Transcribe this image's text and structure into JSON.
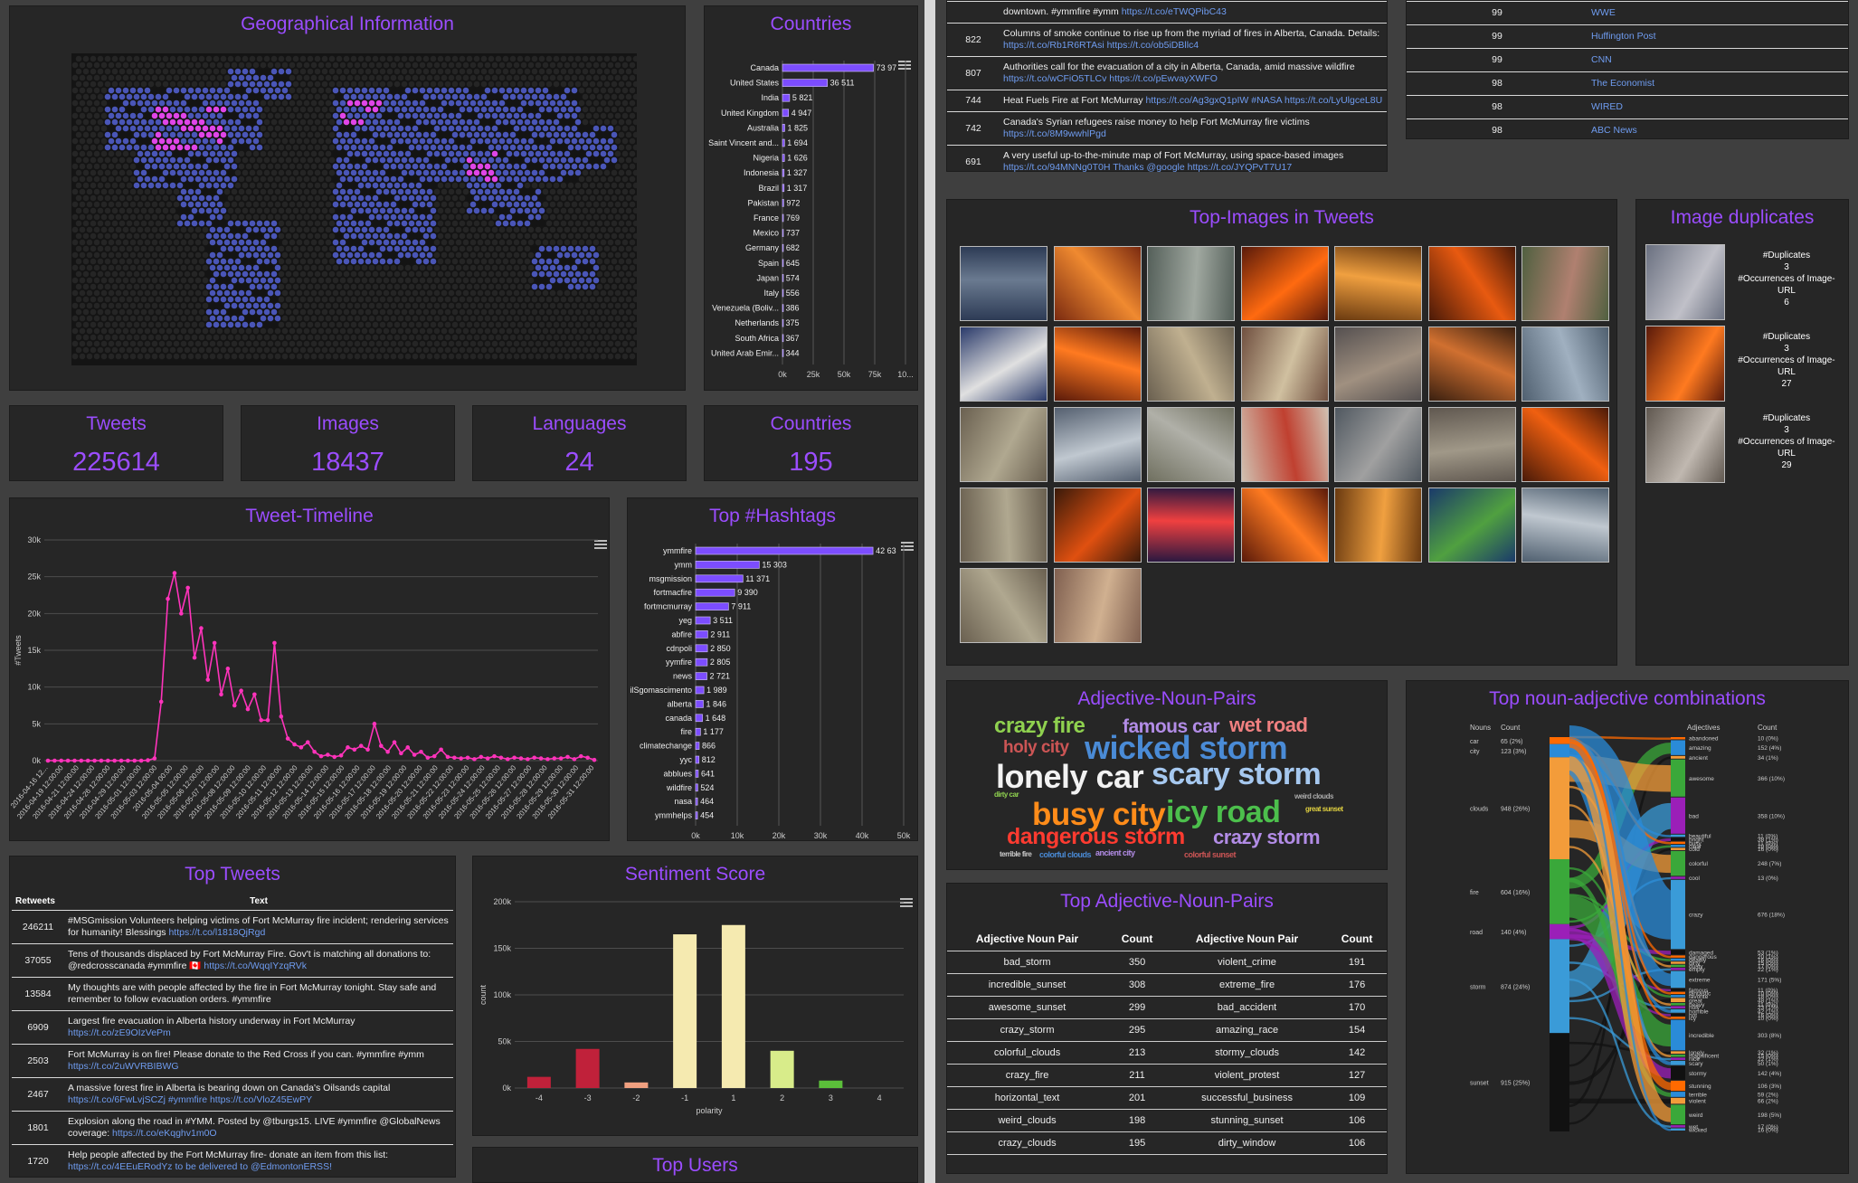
{
  "geo": {
    "title": "Geographical Information"
  },
  "countries_chart": {
    "title": "Countries",
    "chart_data": {
      "type": "bar",
      "orientation": "horizontal",
      "categories": [
        "Canada",
        "United States",
        "India",
        "United Kingdom",
        "Australia",
        "Saint Vincent and...",
        "Nigeria",
        "Indonesia",
        "Brazil",
        "Pakistan",
        "France",
        "Mexico",
        "Germany",
        "Spain",
        "Japan",
        "Italy",
        "Venezuela (Boliv...",
        "Netherlands",
        "South Africa",
        "United Arab Emir..."
      ],
      "values": [
        73970,
        36511,
        5821,
        4947,
        1825,
        1694,
        1626,
        1327,
        1317,
        972,
        769,
        737,
        682,
        645,
        574,
        556,
        386,
        375,
        367,
        344
      ],
      "value_labels": [
        "73 97",
        "36 511",
        "5 821",
        "4 947",
        "1 825",
        "1 694",
        "1 626",
        "1 327",
        "1 317",
        "972",
        "769",
        "737",
        "682",
        "645",
        "574",
        "556",
        "386",
        "375",
        "367",
        "344"
      ],
      "x_ticks": [
        "0k",
        "25k",
        "50k",
        "75k",
        "10..."
      ],
      "xlim": [
        0,
        100000
      ],
      "bar_color": "#7c4dff"
    }
  },
  "stats": [
    {
      "label": "Tweets",
      "value": "225614"
    },
    {
      "label": "Images",
      "value": "18437"
    },
    {
      "label": "Languages",
      "value": "24"
    },
    {
      "label": "Countries",
      "value": "195"
    }
  ],
  "timeline": {
    "title": "Tweet-Timeline",
    "chart_data": {
      "type": "line",
      "ylabel": "#Tweets",
      "ylim": [
        0,
        30000
      ],
      "y_ticks": [
        "0k",
        "5k",
        "10k",
        "15k",
        "20k",
        "25k",
        "30k"
      ],
      "x_ticks": [
        "2016-04-16 12...",
        "2016-04-19 12:00:00",
        "2016-04-21 12:00:00",
        "2016-04-24 12:00:00",
        "2016-04-26 12:00:00",
        "2016-04-29 12:00:00",
        "2016-05-01 12:00:00",
        "2016-05-03 12:00:00",
        "2016-05-04 00:00",
        "2016-05-05 12:00:00",
        "2016-05-06 12:00:00",
        "2016-05-07 12:00:00",
        "2016-05-08 12:00:00",
        "2016-05-09 12:00:00",
        "2016-05-10 12:00:00",
        "2016-05-11 12:00:00",
        "2016-05-12 12:00:00",
        "2016-05-13 12:00:00",
        "2016-05-14 12:00:00",
        "2016-05-15 12:00:00",
        "2016-05-16 12:00:00",
        "2016-05-17 12:00:00",
        "2016-05-18 12:00:00",
        "2016-05-19 12:00:00",
        "2016-05-20 12:00:00",
        "2016-05-21 12:00:00",
        "2016-05-22 12:00:00",
        "2016-05-23 12:00:00",
        "2016-05-24 12:00:00",
        "2016-05-25 12:00:00",
        "2016-05-26 12:00:00",
        "2016-05-27 12:00:00",
        "2016-05-28 12:00:00",
        "2016-05-29 12:00:00",
        "2016-05-30 12:00:00",
        "2016-05-31 12:00:00"
      ],
      "values": [
        0,
        0,
        0,
        0,
        0,
        0,
        0,
        0,
        0,
        0,
        0,
        0,
        0,
        0,
        0,
        50,
        300,
        8000,
        22000,
        25500,
        20000,
        23500,
        14000,
        18000,
        11000,
        16000,
        9000,
        12500,
        7500,
        9500,
        7000,
        9000,
        5500,
        5500,
        16000,
        6000,
        3000,
        2200,
        1800,
        2500,
        1200,
        600,
        800,
        500,
        700,
        1800,
        1500,
        2000,
        1500,
        5000,
        2000,
        1200,
        2500,
        1000,
        1800,
        800,
        1200,
        400,
        600,
        1500,
        500,
        400,
        300,
        400,
        200,
        500,
        300,
        600,
        400,
        200,
        400,
        300,
        200,
        400,
        300,
        200,
        300,
        300,
        500,
        200,
        600,
        400,
        100
      ],
      "color": "#ff33bb"
    }
  },
  "hashtags": {
    "title": "Top #Hashtags",
    "chart_data": {
      "type": "bar",
      "orientation": "horizontal",
      "categories": [
        "ymmfire",
        "ymm",
        "msgmission",
        "fortmacfire",
        "fortmcmurray",
        "yeg",
        "abfire",
        "cdnpoli",
        "yymfire",
        "news",
        "ilSgomascimento",
        "alberta",
        "canada",
        "fire",
        "climatechange",
        "yyc",
        "abblues",
        "wildfire",
        "nasa",
        "ymmhelps"
      ],
      "values": [
        42630,
        15303,
        11371,
        9390,
        7911,
        3511,
        2911,
        2850,
        2805,
        2721,
        1989,
        1846,
        1648,
        1177,
        866,
        812,
        641,
        524,
        464,
        454
      ],
      "value_labels": [
        "42 63",
        "15 303",
        "11 371",
        "9 390",
        "7 911",
        "3 511",
        "2 911",
        "2 850",
        "2 805",
        "2 721",
        "1 989",
        "1 846",
        "1 648",
        "1 177",
        "866",
        "812",
        "641",
        "524",
        "464",
        "454"
      ],
      "x_ticks": [
        "0k",
        "10k",
        "20k",
        "30k",
        "40k",
        "50k"
      ],
      "xlim": [
        0,
        50000
      ],
      "bar_color": "#7c4dff"
    }
  },
  "top_tweets": {
    "title": "Top Tweets",
    "col_retweets": "Retweets",
    "col_text": "Text",
    "rows": [
      {
        "count": "246211",
        "text": "#MSGmission Volunteers helping victims of Fort McMurray fire incident; rendering services for humanity! Blessings ",
        "link": "https://t.co/l1818QjRgd",
        "text2": ""
      },
      {
        "count": "37055",
        "text": "Tens of thousands displaced by Fort McMurray Fire. Gov't is matching all donations to: @redcrosscanada #ymmfire 🇨🇦 ",
        "link": "https://t.co/WqqIYzqRVk",
        "text2": ""
      },
      {
        "count": "13584",
        "text": "My thoughts are with people affected by the fire in Fort McMurray tonight. Stay safe and remember to follow evacuation orders. #ymmfire",
        "link": "",
        "text2": ""
      },
      {
        "count": "6909",
        "text": "Largest fire evacuation in Alberta history underway in Fort McMurray ",
        "link": "https://t.co/zE9OIzVePm",
        "text2": ""
      },
      {
        "count": "2503",
        "text": "Fort McMurray is on fire! Please donate to the Red Cross if you can. #ymmfire #ymm ",
        "link": "https://t.co/2uWVRBIBWG",
        "text2": ""
      },
      {
        "count": "2467",
        "text": "A massive forest fire in Alberta is bearing down on Canada's Oilsands capital ",
        "link": "https://t.co/6FwLvjSCZj",
        "text2": " #ymmfire https://t.co/VloZ45EwPY"
      },
      {
        "count": "1801",
        "text": "Explosion along the road in #YMM. Posted by @tburgs15. LIVE #ymmfire @GlobalNews coverage: ",
        "link": "https://t.co/eKqghv1m0O",
        "text2": ""
      },
      {
        "count": "1720",
        "text": "Help people affected by the Fort McMurray fire- donate an item from this list: ",
        "link": "https://t.co/4EEuERodYz",
        "text2": " to be delivered to @EdmontonERSS!"
      }
    ]
  },
  "sentiment": {
    "title": "Sentiment Score",
    "chart_data": {
      "type": "bar",
      "xlabel": "polarity",
      "ylabel": "count",
      "categories": [
        "-4",
        "-3",
        "-2",
        "-1",
        "1",
        "2",
        "3",
        "4"
      ],
      "values": [
        12000,
        42000,
        6000,
        165000,
        175000,
        40000,
        8000,
        0
      ],
      "colors": [
        "#c0213a",
        "#c0213a",
        "#f0a080",
        "#f5eab0",
        "#f5eab0",
        "#d8ec8a",
        "#5bbf3a",
        "#5bbf3a"
      ],
      "y_ticks": [
        "0k",
        "50k",
        "100k",
        "150k",
        "200k"
      ],
      "ylim": [
        0,
        200000
      ]
    }
  },
  "top_users": {
    "title": "Top Users"
  },
  "right_tweets": [
    {
      "count": "",
      "text": "downtown. #ymmfire #ymm ",
      "link": "https://t.co/eTWQPibC43"
    },
    {
      "count": "822",
      "text": "Columns of smoke continue to rise up from the myriad of fires in Alberta, Canada. Details: ",
      "link": "https://t.co/Rb1R6RTAsi https://t.co/ob5iDBllc4"
    },
    {
      "count": "807",
      "text": "Authorities call for the evacuation of a city in Alberta, Canada, amid massive wildfire ",
      "link": "https://t.co/wCFiO5TLCv https://t.co/pEwvayXWFO"
    },
    {
      "count": "744",
      "text": "Heat Fuels Fire at Fort McMurray ",
      "link": "https://t.co/Ag3gxQ1pIW #NASA https://t.co/LyUlgceL8U"
    },
    {
      "count": "742",
      "text": "Canada's Syrian refugees raise money to help Fort McMurray fire victims ",
      "link": "https://t.co/8M9wwhlPgd"
    },
    {
      "count": "691",
      "text": "A very useful up-to-the-minute map of Fort McMurray, using space-based images ",
      "link": "https://t.co/94MNNg0T0H Thanks @google https://t.co/JYQPvT7U17"
    }
  ],
  "users_list": [
    {
      "count": "99",
      "name": "WWE"
    },
    {
      "count": "99",
      "name": "Huffington Post"
    },
    {
      "count": "99",
      "name": "CNN"
    },
    {
      "count": "98",
      "name": "The Economist"
    },
    {
      "count": "98",
      "name": "WIRED"
    },
    {
      "count": "98",
      "name": "ABC News"
    }
  ],
  "top_images": {
    "title": "Top-Images in Tweets"
  },
  "image_dups": {
    "title": "Image duplicates",
    "items": [
      {
        "dup_label": "#Duplicates",
        "dup": "3",
        "occ_label": "#Occurrences of Image-URL",
        "occ": "6"
      },
      {
        "dup_label": "#Duplicates",
        "dup": "3",
        "occ_label": "#Occurrences of Image-URL",
        "occ": "27"
      },
      {
        "dup_label": "#Duplicates",
        "dup": "3",
        "occ_label": "#Occurrences of Image-URL",
        "occ": "29"
      }
    ]
  },
  "wordcloud": {
    "title": "Adjective-Noun-Pairs",
    "words": [
      {
        "text": "crazy fire",
        "color": "#8fd14f",
        "size": 24
      },
      {
        "text": "famous car",
        "color": "#b28ce6",
        "size": 21
      },
      {
        "text": "wet road",
        "color": "#f08080",
        "size": 22
      },
      {
        "text": "holy city",
        "color": "#cc5555",
        "size": 19
      },
      {
        "text": "wicked storm",
        "color": "#4a8bd6",
        "size": 36
      },
      {
        "text": "lonely car",
        "color": "#f2f2f2",
        "size": 36
      },
      {
        "text": "scary storm",
        "color": "#a6c8ef",
        "size": 34
      },
      {
        "text": "dirty car",
        "color": "#8fd14f",
        "size": 8
      },
      {
        "text": "weird clouds",
        "color": "#aaaaaa",
        "size": 8
      },
      {
        "text": "busy city",
        "color": "#ff8c1a",
        "size": 35
      },
      {
        "text": "icy road",
        "color": "#4cbf4c",
        "size": 34
      },
      {
        "text": "great sunset",
        "color": "#e0d040",
        "size": 8
      },
      {
        "text": "dangerous storm",
        "color": "#ff3b30",
        "size": 25
      },
      {
        "text": "crazy storm",
        "color": "#b28ce6",
        "size": 22
      },
      {
        "text": "terrible fire",
        "color": "#cccccc",
        "size": 8
      },
      {
        "text": "colorful clouds",
        "color": "#4a8bd6",
        "size": 9
      },
      {
        "text": "ancient city",
        "color": "#b28ce6",
        "size": 9
      },
      {
        "text": "colorful sunset",
        "color": "#cc5555",
        "size": 9
      }
    ]
  },
  "anp_table": {
    "title": "Top Adjective-Noun-Pairs",
    "headers": [
      "Adjective Noun Pair",
      "Count",
      "Adjective Noun Pair",
      "Count"
    ],
    "rows": [
      [
        "bad_storm",
        "350",
        "violent_crime",
        "191"
      ],
      [
        "incredible_sunset",
        "308",
        "extreme_fire",
        "176"
      ],
      [
        "awesome_sunset",
        "299",
        "bad_accident",
        "170"
      ],
      [
        "crazy_storm",
        "295",
        "amazing_race",
        "154"
      ],
      [
        "colorful_clouds",
        "213",
        "stormy_clouds",
        "142"
      ],
      [
        "crazy_fire",
        "211",
        "violent_protest",
        "127"
      ],
      [
        "horizontal_text",
        "201",
        "successful_business",
        "109"
      ],
      [
        "weird_clouds",
        "198",
        "stunning_sunset",
        "106"
      ],
      [
        "crazy_clouds",
        "195",
        "dirty_window",
        "106"
      ]
    ]
  },
  "noun_adj": {
    "title": "Top noun-adjective combinations",
    "col_nouns": "Nouns",
    "col_count": "Count",
    "col_adj": "Adjectives",
    "col_count2": "Count",
    "nouns": [
      {
        "name": "car",
        "count": "65",
        "pct": "(2%)",
        "color": "#ff6a00"
      },
      {
        "name": "city",
        "count": "123",
        "pct": "(3%)",
        "color": "#2a8bd8"
      },
      {
        "name": "clouds",
        "count": "948",
        "pct": "(26%)",
        "color": "#f39c3a"
      },
      {
        "name": "fire",
        "count": "604",
        "pct": "(16%)",
        "color": "#3aa83a"
      },
      {
        "name": "road",
        "count": "140",
        "pct": "(4%)",
        "color": "#9b1fb8"
      },
      {
        "name": "storm",
        "count": "874",
        "pct": "(24%)",
        "color": "#3a9bd8"
      },
      {
        "name": "sunset",
        "count": "915",
        "pct": "(25%)",
        "color": "#111111"
      }
    ],
    "adjectives": [
      {
        "name": "abandoned",
        "count": "10",
        "pct": "(0%)"
      },
      {
        "name": "amazing",
        "count": "152",
        "pct": "(4%)"
      },
      {
        "name": "ancient",
        "count": "34",
        "pct": "(1%)"
      },
      {
        "name": "awesome",
        "count": "366",
        "pct": "(10%)"
      },
      {
        "name": "bad",
        "count": "358",
        "pct": "(10%)"
      },
      {
        "name": "beautiful",
        "count": "11",
        "pct": "(0%)"
      },
      {
        "name": "bright",
        "count": "38",
        "pct": "(1%)"
      },
      {
        "name": "busy",
        "count": "11",
        "pct": "(0%)"
      },
      {
        "name": "clear",
        "count": "10",
        "pct": "(0%)"
      },
      {
        "name": "cold",
        "count": "16",
        "pct": "(0%)"
      },
      {
        "name": "colorful",
        "count": "248",
        "pct": "(7%)"
      },
      {
        "name": "cool",
        "count": "13",
        "pct": "(0%)"
      },
      {
        "name": "crazy",
        "count": "676",
        "pct": "(18%)"
      },
      {
        "name": "damaged",
        "count": "53",
        "pct": "(1%)"
      },
      {
        "name": "dangerous",
        "count": "20",
        "pct": "(1%)"
      },
      {
        "name": "deadly",
        "count": "16",
        "pct": "(0%)"
      },
      {
        "name": "dirty",
        "count": "15",
        "pct": "(0%)"
      },
      {
        "name": "dusty",
        "count": "17",
        "pct": "(0%)"
      },
      {
        "name": "empty",
        "count": "22",
        "pct": "(1%)"
      },
      {
        "name": "extreme",
        "count": "171",
        "pct": "(5%)"
      },
      {
        "name": "famous",
        "count": "11",
        "pct": "(0%)"
      },
      {
        "name": "fantastic",
        "count": "10",
        "pct": "(0%)"
      },
      {
        "name": "favorite",
        "count": "18",
        "pct": "(0%)"
      },
      {
        "name": "great",
        "count": "48",
        "pct": "(1%)"
      },
      {
        "name": "heavy",
        "count": "11",
        "pct": "(0%)"
      },
      {
        "name": "holy",
        "count": "23",
        "pct": "(1%)"
      },
      {
        "name": "horrible",
        "count": "42",
        "pct": "(1%)"
      },
      {
        "name": "hot",
        "count": "16",
        "pct": "(0%)"
      },
      {
        "name": "icy",
        "count": "10",
        "pct": "(0%)"
      },
      {
        "name": "incredible",
        "count": "303",
        "pct": "(8%)"
      },
      {
        "name": "lonely",
        "count": "32",
        "pct": "(1%)"
      },
      {
        "name": "magnificent",
        "count": "15",
        "pct": "(0%)"
      },
      {
        "name": "nice",
        "count": "22",
        "pct": "(1%)"
      },
      {
        "name": "scary",
        "count": "50",
        "pct": "(1%)"
      },
      {
        "name": "stormy",
        "count": "142",
        "pct": "(4%)"
      },
      {
        "name": "stunning",
        "count": "106",
        "pct": "(3%)"
      },
      {
        "name": "terrible",
        "count": "59",
        "pct": "(2%)"
      },
      {
        "name": "violent",
        "count": "66",
        "pct": "(2%)"
      },
      {
        "name": "weird",
        "count": "198",
        "pct": "(5%)"
      },
      {
        "name": "wet",
        "count": "17",
        "pct": "(0%)"
      },
      {
        "name": "wicked",
        "count": "16",
        "pct": "(0%)"
      }
    ]
  },
  "colors": {
    "accent": "#9b4dff",
    "bar": "#7c4dff",
    "line": "#ff33bb",
    "link": "#6f9cf0",
    "panel": "#262626",
    "background": "#3f3f3f"
  }
}
